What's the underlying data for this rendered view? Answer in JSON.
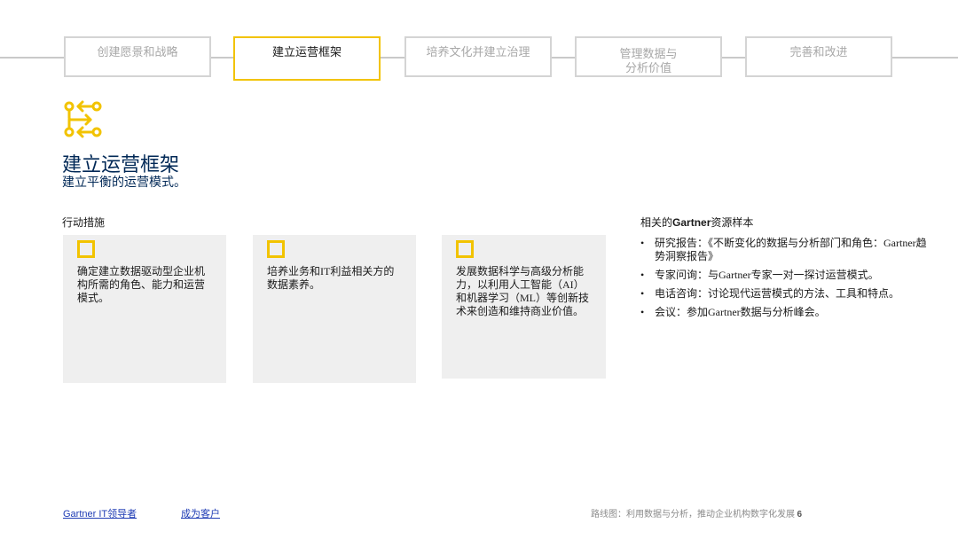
{
  "steps": [
    {
      "label": "创建愿景和战略"
    },
    {
      "label": "建立运营框架"
    },
    {
      "label": "培养文化并建立治理"
    },
    {
      "label": "管理数据与\n分析价值"
    },
    {
      "label": "完善和改进"
    }
  ],
  "active_step": 1,
  "icon": "workflow-arrows-icon",
  "title": "建立运营框架",
  "subtitle": "建立平衡的运营模式。",
  "actions": {
    "label": "行动措施",
    "cards": [
      {
        "text": "确定建立数据驱动型企业机构所需的角色、能力和运营模式。"
      },
      {
        "text": "培养业务和IT利益相关方的数据素养。"
      },
      {
        "text": "发展数据科学与高级分析能力，以利用人工智能（AI）和机器学习（ML）等创新技术来创造和维持商业价值。"
      }
    ]
  },
  "resources": {
    "label_prefix": "相关的",
    "label_brand": "Gartner",
    "label_suffix": "资源样本",
    "items": [
      {
        "text": "研究报告：《不断变化的数据与分析部门和角色：Gartner趋势洞察报告》"
      },
      {
        "text": "专家问询：与Gartner专家一对一探讨运营模式。"
      },
      {
        "text": "电话咨询：讨论现代运营模式的方法、工具和特点。"
      },
      {
        "text": "会议：参加Gartner数据与分析峰会。"
      }
    ],
    "bullet": "•"
  },
  "footer": {
    "link1": "Gartner IT领导者",
    "link2": "成为客户",
    "note": "路线图：利用数据与分析，推动企业机构数字化发展",
    "page": "6"
  },
  "colors": {
    "accent": "#f2c300",
    "title": "#002856",
    "card": "#efefef",
    "link": "#1f3cb5"
  }
}
